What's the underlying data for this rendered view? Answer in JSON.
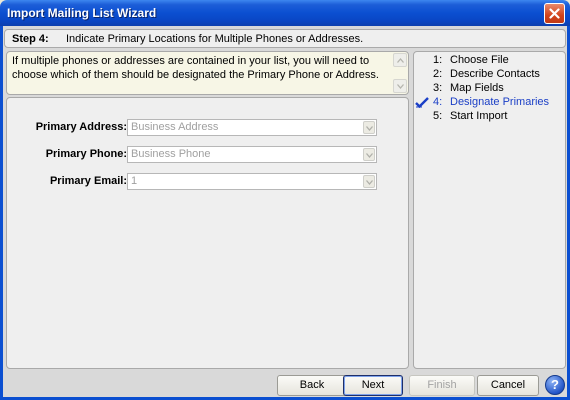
{
  "window": {
    "title": "Import Mailing List Wizard"
  },
  "step_header": {
    "label": "Step 4:",
    "text": "Indicate Primary Locations for Multiple Phones or Addresses."
  },
  "info": {
    "text": "If multiple phones or addresses are contained in your list, you will need to choose which of them should be designated the Primary Phone or Address."
  },
  "fields": [
    {
      "label": "Primary Address:",
      "value": "Business Address"
    },
    {
      "label": "Primary Phone:",
      "value": "Business Phone"
    },
    {
      "label": "Primary Email:",
      "value": "1"
    }
  ],
  "steps": [
    {
      "num": "1:",
      "name": "Choose File"
    },
    {
      "num": "2:",
      "name": "Describe Contacts"
    },
    {
      "num": "3:",
      "name": "Map Fields"
    },
    {
      "num": "4:",
      "name": "Designate Primaries",
      "current": true
    },
    {
      "num": "5:",
      "name": "Start Import"
    }
  ],
  "buttons": {
    "back": "Back",
    "next": "Next",
    "finish": "Finish",
    "cancel": "Cancel",
    "help": "?"
  },
  "colors": {
    "title_bar": "#0b4fd1",
    "current_step": "#1b3fc6",
    "info_bg": "#f7f6e6"
  },
  "icons": {
    "close": "close-icon",
    "help": "help-icon",
    "current_step_marker": "checkmark-icon",
    "dropdown": "chevron-down-icon"
  }
}
